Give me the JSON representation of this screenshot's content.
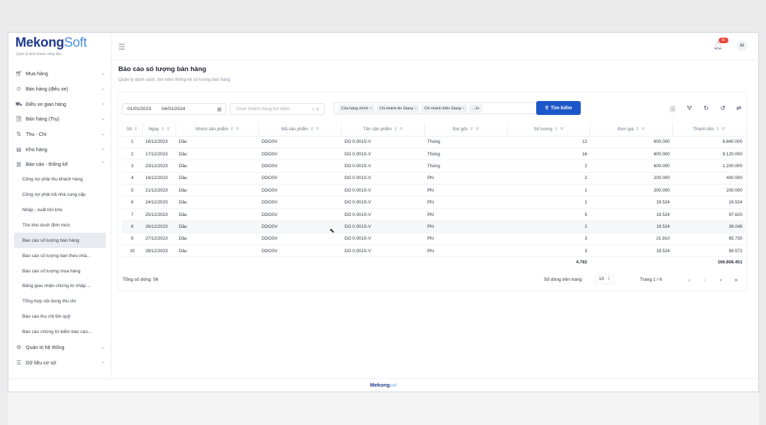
{
  "brand": {
    "name_a": "Mekong",
    "name_b": "Soft",
    "tagline": "Quản lý kinh doanh xăng dầu",
    "footer_a": "Mekong",
    "footer_b": "soft"
  },
  "header": {
    "notif_count": "9+",
    "avatar": "M"
  },
  "sidebar": {
    "items": [
      {
        "label": "Mua hàng",
        "icon": "cart-icon"
      },
      {
        "label": "Bán hàng (điều xe)",
        "icon": "clock-icon"
      },
      {
        "label": "Điều xe giao hàng",
        "icon": "truck-icon"
      },
      {
        "label": "Bán hàng (Trụ)",
        "icon": "pump-icon"
      },
      {
        "label": "Thu - Chi",
        "icon": "exchange-icon"
      },
      {
        "label": "Kho hàng",
        "icon": "warehouse-icon"
      },
      {
        "label": "Báo cáo - thống kê",
        "icon": "chart-icon"
      }
    ],
    "reports": [
      "Công nợ phải thu khách hàng",
      "Công nợ phải trả nhà cung cấp",
      "Nhập - xuất tồn kho",
      "Tồn kho dưới định mức",
      "Báo cáo số lượng bán hàng",
      "Báo cáo số lượng bán theo nhà...",
      "Báo cáo số lượng mua hàng",
      "Bảng giao nhận chứng từ nhập ...",
      "Tổng hợp nội dung thu chi",
      "Báo cáo thu chi tồn quỹ",
      "Báo cáo chứng từ kiểm báo cáo..."
    ],
    "bottom": [
      {
        "label": "Quản trị hệ thống",
        "icon": "settings-icon"
      },
      {
        "label": "Dữ liệu cơ sở",
        "icon": "database-icon"
      }
    ]
  },
  "page": {
    "title": "Báo cáo số lượng bán hàng",
    "subtitle": "Quản lý danh sách, tìm kiếm thống kê số lượng bán hàng"
  },
  "filters": {
    "date_from": "01/01/2023",
    "date_to": "04/01/2024",
    "customer_placeholder": "Chọn khách hàng tìm kiếm",
    "tags": [
      "Cửa hàng chính",
      "Chi nhánh An Giang",
      "Chi nhánh Kiên Giang"
    ],
    "more": "...3+",
    "search_label": "Tìm kiếm"
  },
  "table": {
    "headers": [
      "Stt",
      "Ngày",
      "Nhóm sản phẩm",
      "Mã sản phẩm",
      "Tên sản phẩm",
      "Đvt gốc",
      "Số lượng",
      "Đơn giá",
      "Thành tiền"
    ],
    "rows": [
      [
        "1",
        "16/12/2023",
        "Dầu",
        "DDOSV",
        "DO 0.001S-V",
        "Thùng",
        "12",
        "600.000",
        "6.840.000"
      ],
      [
        "2",
        "17/12/2023",
        "Dầu",
        "DDOSV",
        "DO 0.001S-V",
        "Thùng",
        "16",
        "600.000",
        "9.120.000"
      ],
      [
        "3",
        "23/12/2023",
        "Dầu",
        "DDOSV",
        "DO 0.001S-V",
        "Thùng",
        "2",
        "600.000",
        "1.200.000"
      ],
      [
        "4",
        "16/12/2023",
        "Dầu",
        "DDOSV",
        "DO 0.001S-V",
        "Phi",
        "2",
        "200.000",
        "400.000"
      ],
      [
        "5",
        "21/12/2023",
        "Dầu",
        "DDOSV",
        "DO 0.001S-V",
        "Phi",
        "1",
        "200.000",
        "200.000"
      ],
      [
        "6",
        "24/12/2023",
        "Dầu",
        "DDOSV",
        "DO 0.001S-V",
        "Phi",
        "1",
        "19.524",
        "19.524"
      ],
      [
        "7",
        "25/12/2023",
        "Dầu",
        "DDOSV",
        "DO 0.001S-V",
        "Phi",
        "5",
        "19.524",
        "97.620"
      ],
      [
        "8",
        "26/12/2023",
        "Dầu",
        "DDOSV",
        "DO 0.001S-V",
        "Phi",
        "2",
        "19.524",
        "39.048"
      ],
      [
        "9",
        "27/12/2023",
        "Dầu",
        "DDOSV",
        "DO 0.001S-V",
        "Phi",
        "3",
        "21.910",
        "65.730"
      ],
      [
        "10",
        "28/12/2023",
        "Dầu",
        "DDOSV",
        "DO 0.001S-V",
        "Phi",
        "3",
        "19.524",
        "58.572"
      ]
    ],
    "total_qty": "4.782",
    "total_amount": "166.808.451"
  },
  "footer": {
    "total_rows": "Tổng số dòng: 56",
    "per_page_label": "Số dòng trên trang",
    "per_page": "10",
    "page_info": "Trang 1 / 6"
  }
}
